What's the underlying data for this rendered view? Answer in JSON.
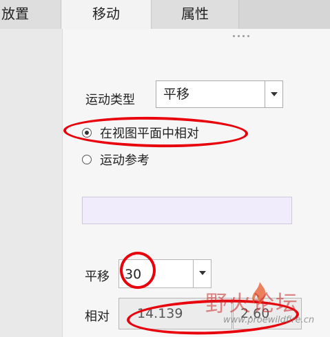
{
  "tabs": [
    {
      "label": "放置"
    },
    {
      "label": "移动"
    },
    {
      "label": "属性"
    }
  ],
  "motion_type": {
    "label": "运动类型",
    "value": "平移"
  },
  "options": [
    {
      "label": "在视图平面中相对",
      "selected": true
    },
    {
      "label": "运动参考",
      "selected": false
    }
  ],
  "translate": {
    "label": "平移",
    "value": "30"
  },
  "relative": {
    "label": "相对",
    "value1": "14.139",
    "value2": "2.60"
  },
  "watermark": {
    "text": "野火论坛",
    "url": "www.proewildfire.cn"
  },
  "colors": {
    "annotation": "#e8000b",
    "reference_box": "#f1ecfb"
  }
}
